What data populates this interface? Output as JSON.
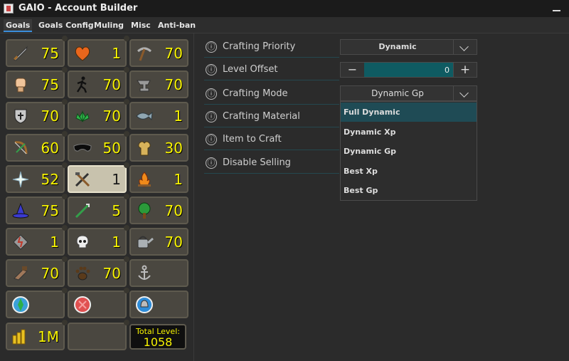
{
  "window": {
    "title": "GAIO - Account Builder"
  },
  "tabs": [
    {
      "label": "Goals"
    },
    {
      "label": "Goals Config"
    },
    {
      "label": "Muling"
    },
    {
      "label": "Misc"
    },
    {
      "label": "Anti-ban"
    }
  ],
  "skills": {
    "attack": "75",
    "hitpoints": "1",
    "mining": "70",
    "strength": "75",
    "agility": "70",
    "smithing": "70",
    "defence": "70",
    "herblore": "70",
    "fishing": "1",
    "ranged": "60",
    "thieving": "50",
    "cooking": "30",
    "prayer": "52",
    "crafting": "1",
    "firemaking": "1",
    "magic": "75",
    "fletching": "5",
    "woodcutting": "70",
    "runecraft": "1",
    "slayer": "1",
    "farming": "70",
    "construction": "70",
    "hunter": "70",
    "coins": "1M"
  },
  "total_level": {
    "label": "Total Level:",
    "value": "1058"
  },
  "settings": {
    "crafting_priority": {
      "label": "Crafting Priority",
      "value": "Dynamic"
    },
    "level_offset": {
      "label": "Level Offset",
      "value": "0"
    },
    "crafting_mode": {
      "label": "Crafting Mode",
      "value": "Dynamic Gp"
    },
    "crafting_material": {
      "label": "Crafting Material"
    },
    "item_to_craft": {
      "label": "Item to Craft"
    },
    "disable_selling": {
      "label": "Disable Selling"
    }
  },
  "mode_options": [
    "Full Dynamic",
    "Dynamic Xp",
    "Dynamic Gp",
    "Best Xp",
    "Best Gp"
  ],
  "colors": {
    "accent": "#3b8edb",
    "level_text": "#f7f300",
    "highlight": "#1f4b55",
    "stepper_field": "#0f5b62"
  },
  "icons": {
    "info": "ⓘ",
    "minus": "−",
    "plus": "+"
  }
}
